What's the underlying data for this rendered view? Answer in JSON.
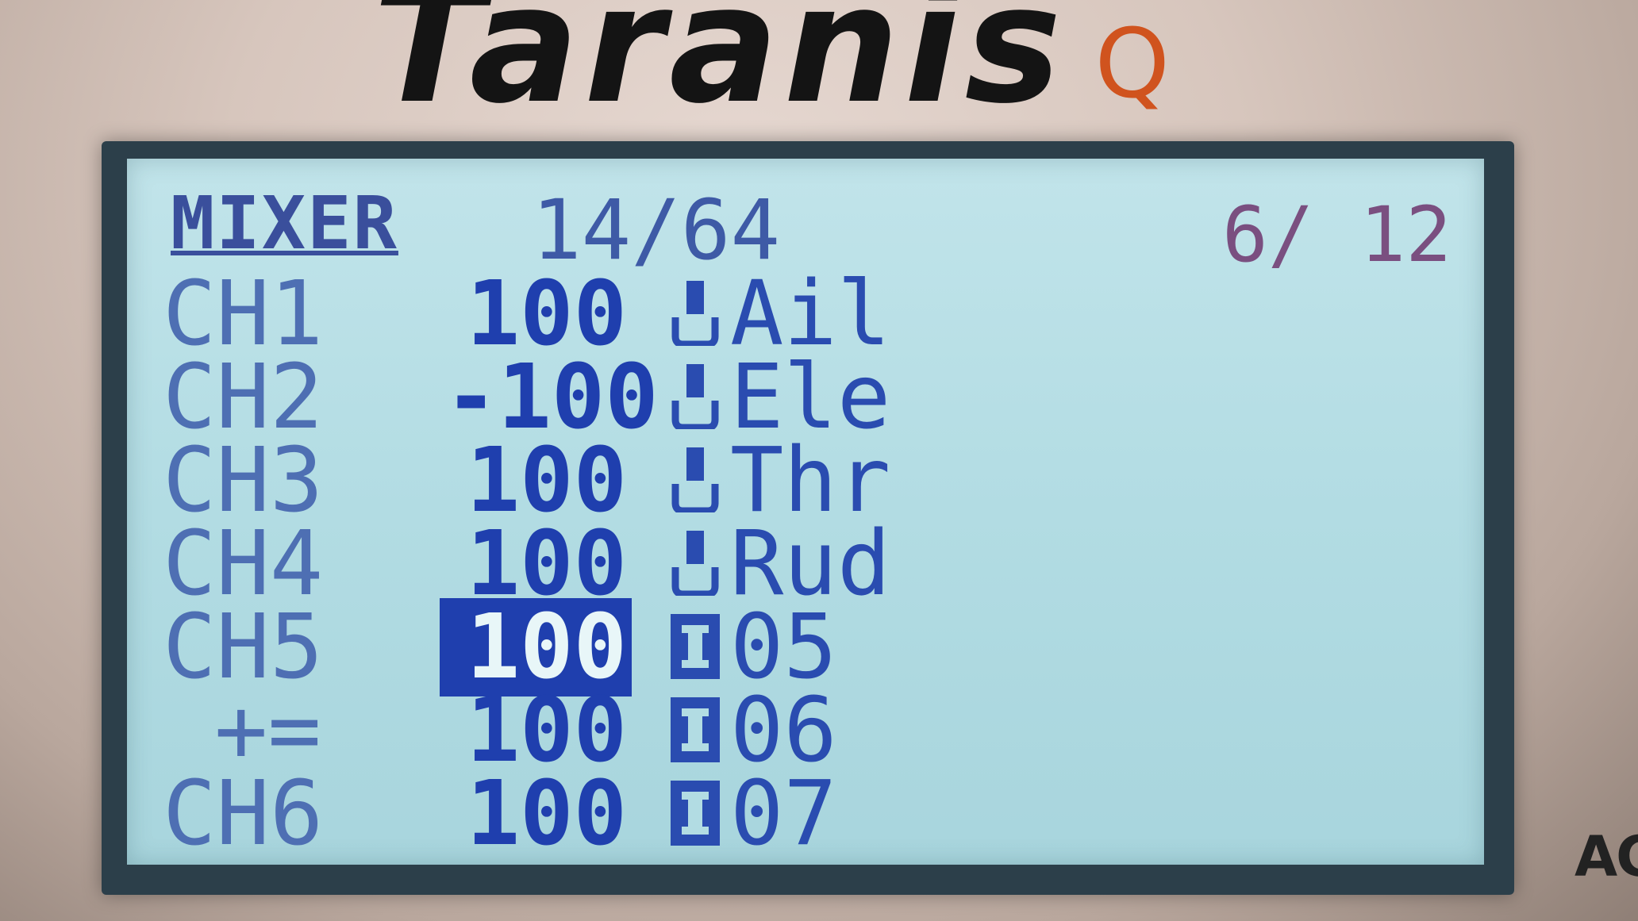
{
  "device": {
    "brand": "Taranis",
    "model": "Q",
    "corner_text": "AC"
  },
  "screen": {
    "title": "MIXER",
    "mix_count": "14/64",
    "page": "6/ 12"
  },
  "mixes": [
    {
      "channel": "CH1",
      "weight": "100",
      "source_icon": "stick-icon",
      "source": "Ail",
      "selected": false
    },
    {
      "channel": "CH2",
      "weight": "-100",
      "source_icon": "stick-icon",
      "source": "Ele",
      "selected": false
    },
    {
      "channel": "CH3",
      "weight": "100",
      "source_icon": "stick-icon",
      "source": "Thr",
      "selected": false
    },
    {
      "channel": "CH4",
      "weight": "100",
      "source_icon": "stick-icon",
      "source": "Rud",
      "selected": false
    },
    {
      "channel": "CH5",
      "weight": "100",
      "source_icon": "input-icon",
      "source": "05",
      "selected": true
    },
    {
      "channel": "+=",
      "weight": "100",
      "source_icon": "input-icon",
      "source": "06",
      "selected": false
    },
    {
      "channel": "CH6",
      "weight": "100",
      "source_icon": "input-icon",
      "source": "07",
      "selected": false
    }
  ],
  "colors": {
    "lcd_background": "#b2dce3",
    "pixel_dark": "#1f3fae",
    "brand_accent": "#d0531e"
  }
}
